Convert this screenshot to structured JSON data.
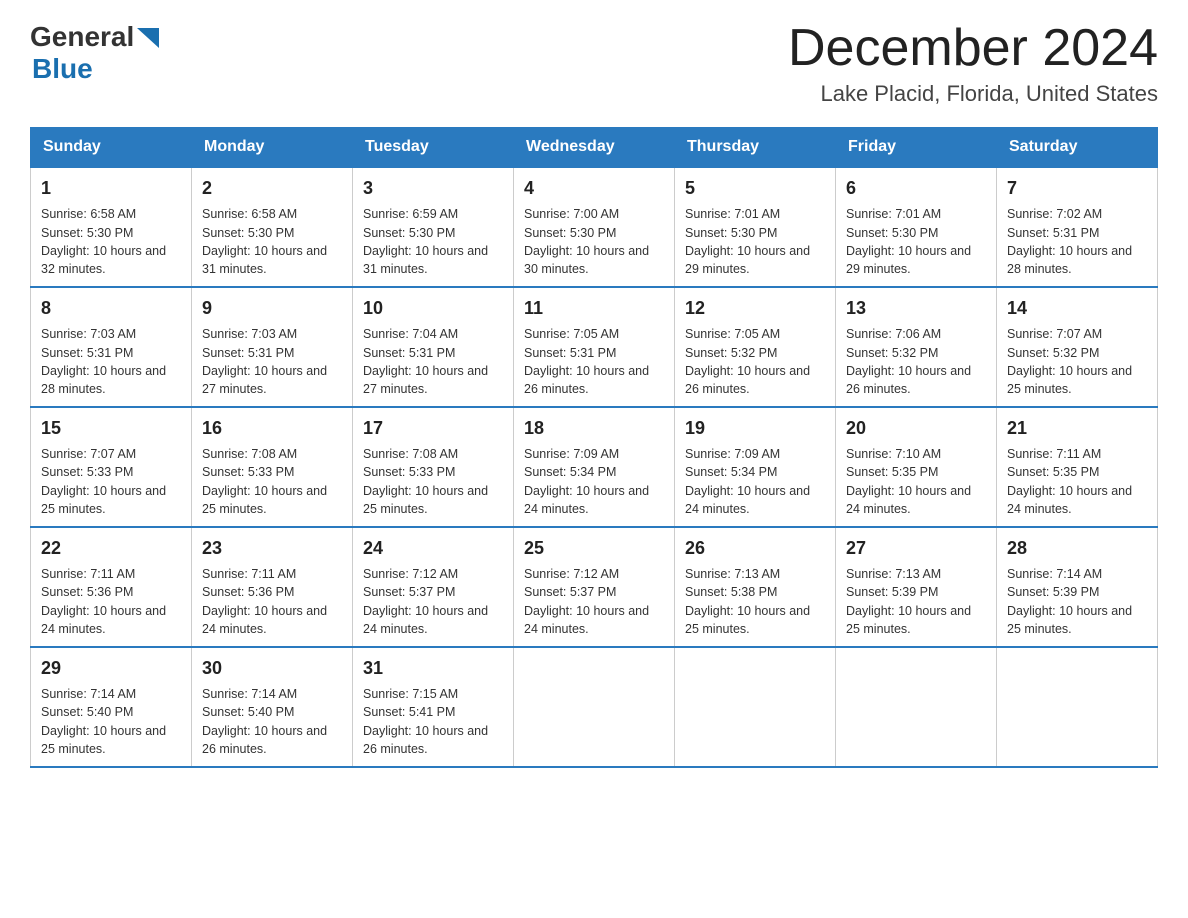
{
  "header": {
    "logo_general": "General",
    "logo_blue": "Blue",
    "month_title": "December 2024",
    "location": "Lake Placid, Florida, United States"
  },
  "weekdays": [
    "Sunday",
    "Monday",
    "Tuesday",
    "Wednesday",
    "Thursday",
    "Friday",
    "Saturday"
  ],
  "weeks": [
    [
      {
        "day": "1",
        "sunrise": "6:58 AM",
        "sunset": "5:30 PM",
        "daylight": "10 hours and 32 minutes."
      },
      {
        "day": "2",
        "sunrise": "6:58 AM",
        "sunset": "5:30 PM",
        "daylight": "10 hours and 31 minutes."
      },
      {
        "day": "3",
        "sunrise": "6:59 AM",
        "sunset": "5:30 PM",
        "daylight": "10 hours and 31 minutes."
      },
      {
        "day": "4",
        "sunrise": "7:00 AM",
        "sunset": "5:30 PM",
        "daylight": "10 hours and 30 minutes."
      },
      {
        "day": "5",
        "sunrise": "7:01 AM",
        "sunset": "5:30 PM",
        "daylight": "10 hours and 29 minutes."
      },
      {
        "day": "6",
        "sunrise": "7:01 AM",
        "sunset": "5:30 PM",
        "daylight": "10 hours and 29 minutes."
      },
      {
        "day": "7",
        "sunrise": "7:02 AM",
        "sunset": "5:31 PM",
        "daylight": "10 hours and 28 minutes."
      }
    ],
    [
      {
        "day": "8",
        "sunrise": "7:03 AM",
        "sunset": "5:31 PM",
        "daylight": "10 hours and 28 minutes."
      },
      {
        "day": "9",
        "sunrise": "7:03 AM",
        "sunset": "5:31 PM",
        "daylight": "10 hours and 27 minutes."
      },
      {
        "day": "10",
        "sunrise": "7:04 AM",
        "sunset": "5:31 PM",
        "daylight": "10 hours and 27 minutes."
      },
      {
        "day": "11",
        "sunrise": "7:05 AM",
        "sunset": "5:31 PM",
        "daylight": "10 hours and 26 minutes."
      },
      {
        "day": "12",
        "sunrise": "7:05 AM",
        "sunset": "5:32 PM",
        "daylight": "10 hours and 26 minutes."
      },
      {
        "day": "13",
        "sunrise": "7:06 AM",
        "sunset": "5:32 PM",
        "daylight": "10 hours and 26 minutes."
      },
      {
        "day": "14",
        "sunrise": "7:07 AM",
        "sunset": "5:32 PM",
        "daylight": "10 hours and 25 minutes."
      }
    ],
    [
      {
        "day": "15",
        "sunrise": "7:07 AM",
        "sunset": "5:33 PM",
        "daylight": "10 hours and 25 minutes."
      },
      {
        "day": "16",
        "sunrise": "7:08 AM",
        "sunset": "5:33 PM",
        "daylight": "10 hours and 25 minutes."
      },
      {
        "day": "17",
        "sunrise": "7:08 AM",
        "sunset": "5:33 PM",
        "daylight": "10 hours and 25 minutes."
      },
      {
        "day": "18",
        "sunrise": "7:09 AM",
        "sunset": "5:34 PM",
        "daylight": "10 hours and 24 minutes."
      },
      {
        "day": "19",
        "sunrise": "7:09 AM",
        "sunset": "5:34 PM",
        "daylight": "10 hours and 24 minutes."
      },
      {
        "day": "20",
        "sunrise": "7:10 AM",
        "sunset": "5:35 PM",
        "daylight": "10 hours and 24 minutes."
      },
      {
        "day": "21",
        "sunrise": "7:11 AM",
        "sunset": "5:35 PM",
        "daylight": "10 hours and 24 minutes."
      }
    ],
    [
      {
        "day": "22",
        "sunrise": "7:11 AM",
        "sunset": "5:36 PM",
        "daylight": "10 hours and 24 minutes."
      },
      {
        "day": "23",
        "sunrise": "7:11 AM",
        "sunset": "5:36 PM",
        "daylight": "10 hours and 24 minutes."
      },
      {
        "day": "24",
        "sunrise": "7:12 AM",
        "sunset": "5:37 PM",
        "daylight": "10 hours and 24 minutes."
      },
      {
        "day": "25",
        "sunrise": "7:12 AM",
        "sunset": "5:37 PM",
        "daylight": "10 hours and 24 minutes."
      },
      {
        "day": "26",
        "sunrise": "7:13 AM",
        "sunset": "5:38 PM",
        "daylight": "10 hours and 25 minutes."
      },
      {
        "day": "27",
        "sunrise": "7:13 AM",
        "sunset": "5:39 PM",
        "daylight": "10 hours and 25 minutes."
      },
      {
        "day": "28",
        "sunrise": "7:14 AM",
        "sunset": "5:39 PM",
        "daylight": "10 hours and 25 minutes."
      }
    ],
    [
      {
        "day": "29",
        "sunrise": "7:14 AM",
        "sunset": "5:40 PM",
        "daylight": "10 hours and 25 minutes."
      },
      {
        "day": "30",
        "sunrise": "7:14 AM",
        "sunset": "5:40 PM",
        "daylight": "10 hours and 26 minutes."
      },
      {
        "day": "31",
        "sunrise": "7:15 AM",
        "sunset": "5:41 PM",
        "daylight": "10 hours and 26 minutes."
      },
      null,
      null,
      null,
      null
    ]
  ]
}
